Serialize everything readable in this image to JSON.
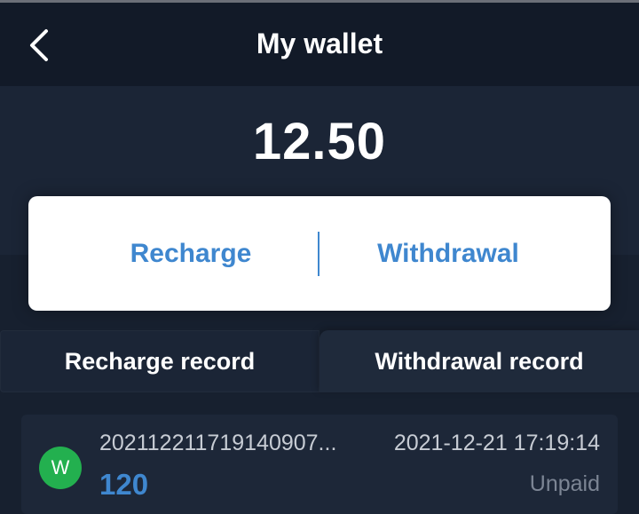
{
  "header": {
    "title": "My wallet",
    "back_icon": "chevron-left-icon"
  },
  "wallet": {
    "balance": "12.50",
    "recharge_label": "Recharge",
    "withdrawal_label": "Withdrawal"
  },
  "tabs": [
    {
      "label": "Recharge record"
    },
    {
      "label": "Withdrawal record"
    }
  ],
  "records": [
    {
      "avatar_letter": "W",
      "order_no": "202112211719140907...",
      "amount": "120",
      "datetime": "2021-12-21 17:19:14",
      "status": "Unpaid"
    }
  ],
  "colors": {
    "background": "#17202f",
    "header": "#121a28",
    "accent": "#3f87cf",
    "avatar_green": "#23b04f",
    "card": "#ffffff"
  }
}
